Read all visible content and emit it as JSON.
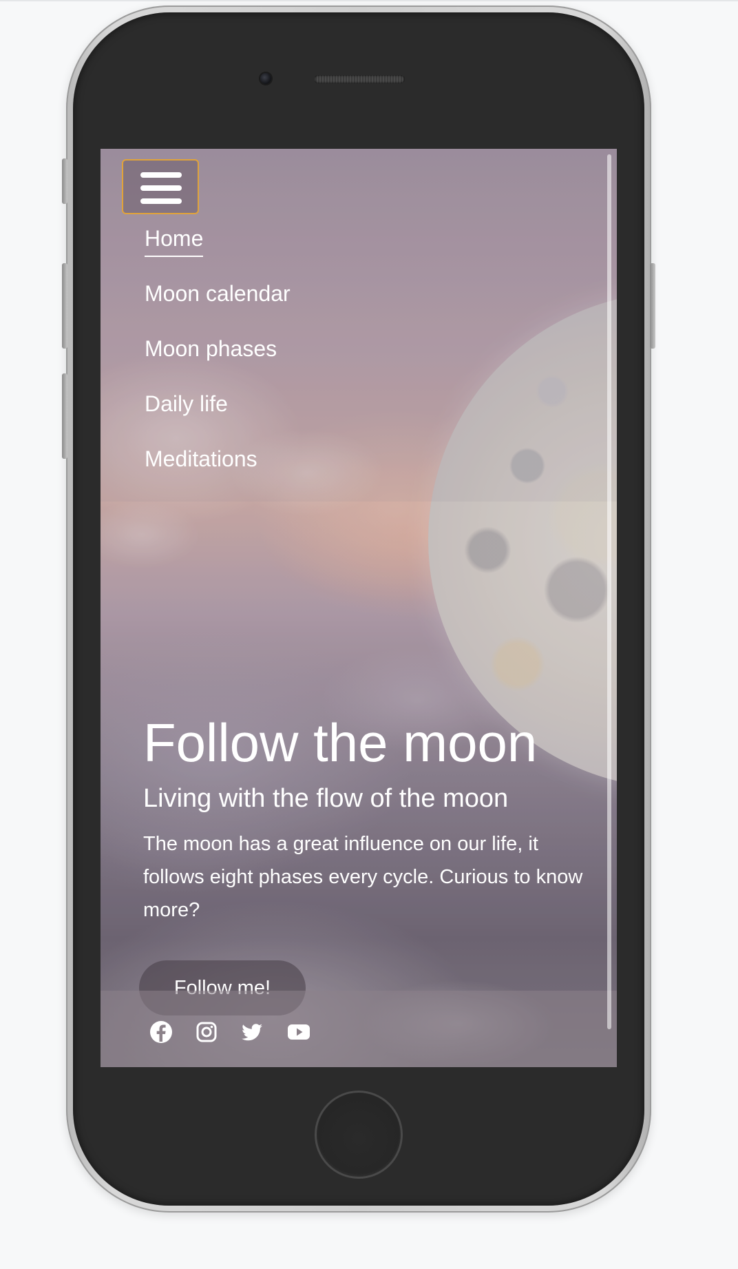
{
  "nav": {
    "items": [
      {
        "label": "Home",
        "active": true
      },
      {
        "label": "Moon calendar",
        "active": false
      },
      {
        "label": "Moon phases",
        "active": false
      },
      {
        "label": "Daily life",
        "active": false
      },
      {
        "label": "Meditations",
        "active": false
      }
    ],
    "menu_icon": "hamburger-icon",
    "menu_border_color": "#e0a33a"
  },
  "hero": {
    "title": "Follow the moon",
    "subtitle": "Living with the flow of the moon",
    "text": "The moon has a great influence on our life, it follows eight phases every cycle. Curious to know more?",
    "cta_label": "Follow me!"
  },
  "footer": {
    "social_icons": [
      "facebook-icon",
      "instagram-icon",
      "twitter-icon",
      "youtube-icon"
    ]
  }
}
